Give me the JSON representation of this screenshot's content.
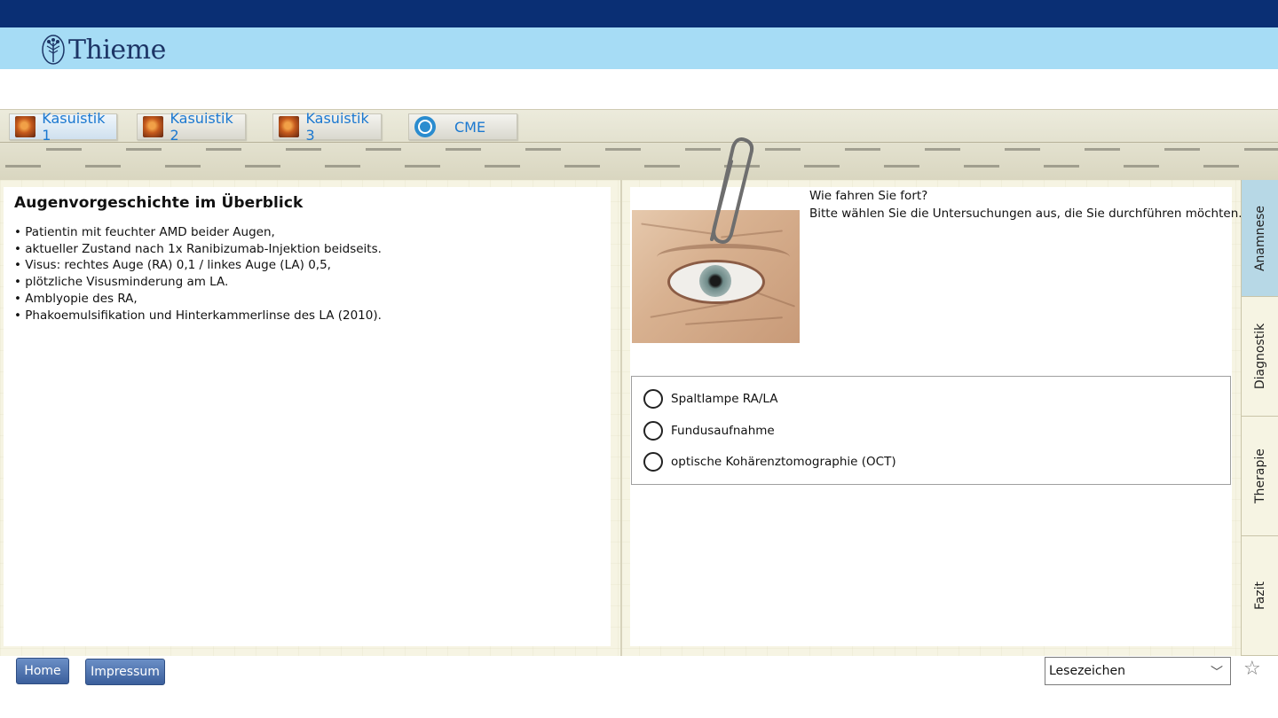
{
  "header": {
    "logo_text": "Thieme"
  },
  "tabs": [
    {
      "label": "Kasuistik 1",
      "icon": "fundus-thumbnail",
      "active": true
    },
    {
      "label": "Kasuistik 2",
      "icon": "fundus-thumbnail",
      "active": false
    },
    {
      "label": "Kasuistik 3",
      "icon": "fundus-thumbnail",
      "active": false
    },
    {
      "label": "CME",
      "icon": "cme-icon",
      "active": false
    }
  ],
  "left_panel": {
    "title": "Augenvorgeschichte im Überblick",
    "items": [
      "Patientin mit feuchter AMD beider Augen,",
      "aktueller Zustand nach 1x Ranibizumab-Injektion beidseits.",
      "Visus: rechtes Auge (RA) 0,1 / linkes Auge (LA) 0,5,",
      "plötzliche Visusminderung am LA.",
      "Amblyopie des RA,",
      "Phakoemulsifikation und Hinterkammerlinse des LA (2010)."
    ]
  },
  "right_panel": {
    "question_line1": "Wie fahren Sie fort?",
    "question_line2": "Bitte wählen Sie die Untersuchungen aus, die Sie durchführen möchten.",
    "options": [
      {
        "label": "Spaltlampe RA/LA",
        "checked": false
      },
      {
        "label": "Fundusaufnahme",
        "checked": false
      },
      {
        "label": "optische Kohärenztomographie (OCT)",
        "checked": false
      }
    ]
  },
  "side_tabs": [
    {
      "label": "Anamnese",
      "active": true
    },
    {
      "label": "Diagnostik",
      "active": false
    },
    {
      "label": "Therapie",
      "active": false
    },
    {
      "label": "Fazit",
      "active": false
    }
  ],
  "footer": {
    "home_label": "Home",
    "impressum_label": "Impressum",
    "bookmark_select_value": "Lesezeichen",
    "star_icon": "star-outline-icon"
  },
  "colors": {
    "top_bar": "#0a2f74",
    "brand_bar": "#a6dcf5",
    "tab_text": "#1b78d0",
    "button": "#4a6fae",
    "active_side_tab": "#b7d8e6"
  }
}
